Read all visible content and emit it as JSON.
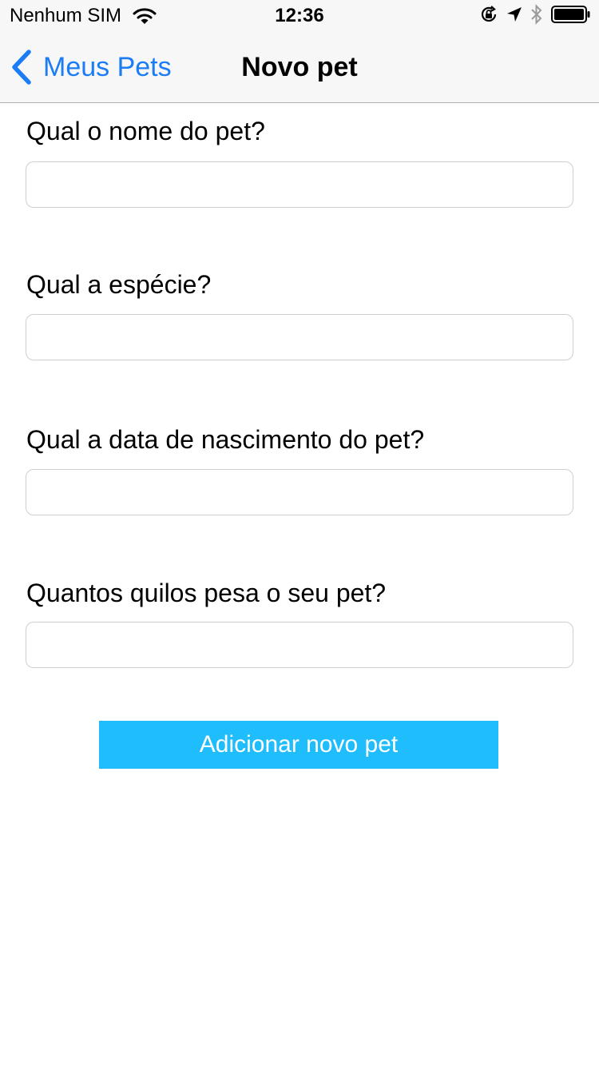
{
  "status_bar": {
    "carrier": "Nenhum SIM",
    "time": "12:36",
    "icons": [
      "wifi-icon",
      "orientation-lock-icon",
      "location-arrow-icon",
      "bluetooth-icon",
      "battery-icon"
    ]
  },
  "nav": {
    "back_label": "Meus Pets",
    "title": "Novo pet",
    "accent_color": "#1b7cf6"
  },
  "form": {
    "fields": [
      {
        "label": "Qual o nome do pet?",
        "value": ""
      },
      {
        "label": "Qual a espécie?",
        "value": ""
      },
      {
        "label": "Qual a data de nascimento do pet?",
        "value": ""
      },
      {
        "label": "Quantos quilos pesa o seu pet?",
        "value": ""
      }
    ],
    "submit_label": "Adicionar novo pet",
    "submit_color": "#1fbdfc"
  }
}
